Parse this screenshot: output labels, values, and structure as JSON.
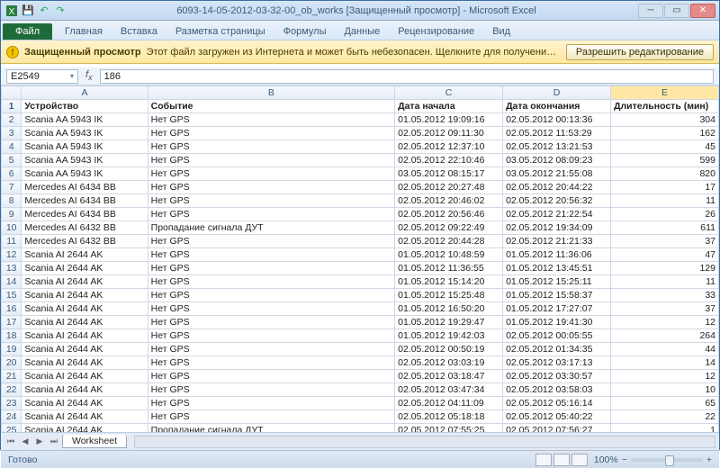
{
  "window": {
    "title": "6093-14-05-2012-03-32-00_ob_works [Защищенный просмотр] - Microsoft Excel"
  },
  "ribbon": {
    "file": "Файл",
    "tabs": [
      "Главная",
      "Вставка",
      "Разметка страницы",
      "Формулы",
      "Данные",
      "Рецензирование",
      "Вид"
    ]
  },
  "protected_view": {
    "header": "Защищенный просмотр",
    "message": "Этот файл загружен из Интернета и может быть небезопасен. Щелкните для получения дополнительных сведений.",
    "enable": "Разрешить редактирование"
  },
  "namebox": {
    "ref": "E2549",
    "formula": "186"
  },
  "columns": [
    "A",
    "B",
    "C",
    "D",
    "E"
  ],
  "selected_column": "E",
  "headers": {
    "device": "Устройство",
    "event": "Событие",
    "start": "Дата начала",
    "end": "Дата окончания",
    "dur": "Длительность (мин)"
  },
  "rows": [
    {
      "n": 2,
      "a": "Scania AA 5943 IK",
      "b": "Нет GPS",
      "c": "01.05.2012 19:09:16",
      "d": "02.05.2012 00:13:36",
      "e": "304"
    },
    {
      "n": 3,
      "a": "Scania AA 5943 IK",
      "b": "Нет GPS",
      "c": "02.05.2012 09:11:30",
      "d": "02.05.2012 11:53:29",
      "e": "162"
    },
    {
      "n": 4,
      "a": "Scania AA 5943 IK",
      "b": "Нет GPS",
      "c": "02.05.2012 12:37:10",
      "d": "02.05.2012 13:21:53",
      "e": "45"
    },
    {
      "n": 5,
      "a": "Scania AA 5943 IK",
      "b": "Нет GPS",
      "c": "02.05.2012 22:10:46",
      "d": "03.05.2012 08:09:23",
      "e": "599"
    },
    {
      "n": 6,
      "a": "Scania AA 5943 IK",
      "b": "Нет GPS",
      "c": "03.05.2012 08:15:17",
      "d": "03.05.2012 21:55:08",
      "e": "820"
    },
    {
      "n": 7,
      "a": "Mercedes AI 6434 BB",
      "b": "Нет GPS",
      "c": "02.05.2012 20:27:48",
      "d": "02.05.2012 20:44:22",
      "e": "17"
    },
    {
      "n": 8,
      "a": "Mercedes AI 6434 BB",
      "b": "Нет GPS",
      "c": "02.05.2012 20:46:02",
      "d": "02.05.2012 20:56:32",
      "e": "11"
    },
    {
      "n": 9,
      "a": "Mercedes AI 6434 BB",
      "b": "Нет GPS",
      "c": "02.05.2012 20:56:46",
      "d": "02.05.2012 21:22:54",
      "e": "26"
    },
    {
      "n": 10,
      "a": "Mercedes AI 6432 BB",
      "b": "Пропадание сигнала ДУТ",
      "c": "02.05.2012 09:22:49",
      "d": "02.05.2012 19:34:09",
      "e": "611"
    },
    {
      "n": 11,
      "a": "Mercedes AI 6432 BB",
      "b": "Нет GPS",
      "c": "02.05.2012 20:44:28",
      "d": "02.05.2012 21:21:33",
      "e": "37"
    },
    {
      "n": 12,
      "a": "Scania AI 2644 AK",
      "b": "Нет GPS",
      "c": "01.05.2012 10:48:59",
      "d": "01.05.2012 11:36:06",
      "e": "47"
    },
    {
      "n": 13,
      "a": "Scania AI 2644 AK",
      "b": "Нет GPS",
      "c": "01.05.2012 11:36:55",
      "d": "01.05.2012 13:45:51",
      "e": "129"
    },
    {
      "n": 14,
      "a": "Scania AI 2644 AK",
      "b": "Нет GPS",
      "c": "01.05.2012 15:14:20",
      "d": "01.05.2012 15:25:11",
      "e": "11"
    },
    {
      "n": 15,
      "a": "Scania AI 2644 AK",
      "b": "Нет GPS",
      "c": "01.05.2012 15:25:48",
      "d": "01.05.2012 15:58:37",
      "e": "33"
    },
    {
      "n": 16,
      "a": "Scania AI 2644 AK",
      "b": "Нет GPS",
      "c": "01.05.2012 16:50:20",
      "d": "01.05.2012 17:27:07",
      "e": "37"
    },
    {
      "n": 17,
      "a": "Scania AI 2644 AK",
      "b": "Нет GPS",
      "c": "01.05.2012 19:29:47",
      "d": "01.05.2012 19:41:30",
      "e": "12"
    },
    {
      "n": 18,
      "a": "Scania AI 2644 AK",
      "b": "Нет GPS",
      "c": "01.05.2012 19:42:03",
      "d": "02.05.2012 00:05:55",
      "e": "264"
    },
    {
      "n": 19,
      "a": "Scania AI 2644 AK",
      "b": "Нет GPS",
      "c": "02.05.2012 00:50:19",
      "d": "02.05.2012 01:34:35",
      "e": "44"
    },
    {
      "n": 20,
      "a": "Scania AI 2644 AK",
      "b": "Нет GPS",
      "c": "02.05.2012 03:03:19",
      "d": "02.05.2012 03:17:13",
      "e": "14"
    },
    {
      "n": 21,
      "a": "Scania AI 2644 AK",
      "b": "Нет GPS",
      "c": "02.05.2012 03:18:47",
      "d": "02.05.2012 03:30:57",
      "e": "12"
    },
    {
      "n": 22,
      "a": "Scania AI 2644 AK",
      "b": "Нет GPS",
      "c": "02.05.2012 03:47:34",
      "d": "02.05.2012 03:58:03",
      "e": "10"
    },
    {
      "n": 23,
      "a": "Scania AI 2644 AK",
      "b": "Нет GPS",
      "c": "02.05.2012 04:11:09",
      "d": "02.05.2012 05:16:14",
      "e": "65"
    },
    {
      "n": 24,
      "a": "Scania AI 2644 AK",
      "b": "Нет GPS",
      "c": "02.05.2012 05:18:18",
      "d": "02.05.2012 05:40:22",
      "e": "22"
    },
    {
      "n": 25,
      "a": "Scania AI 2644 AK",
      "b": "Пропадание сигнала ДУТ",
      "c": "02.05.2012 07:55:25",
      "d": "02.05.2012 07:56:27",
      "e": "1"
    }
  ],
  "sheet": {
    "name": "Worksheet"
  },
  "status": {
    "ready": "Готово",
    "zoom": "100%"
  }
}
